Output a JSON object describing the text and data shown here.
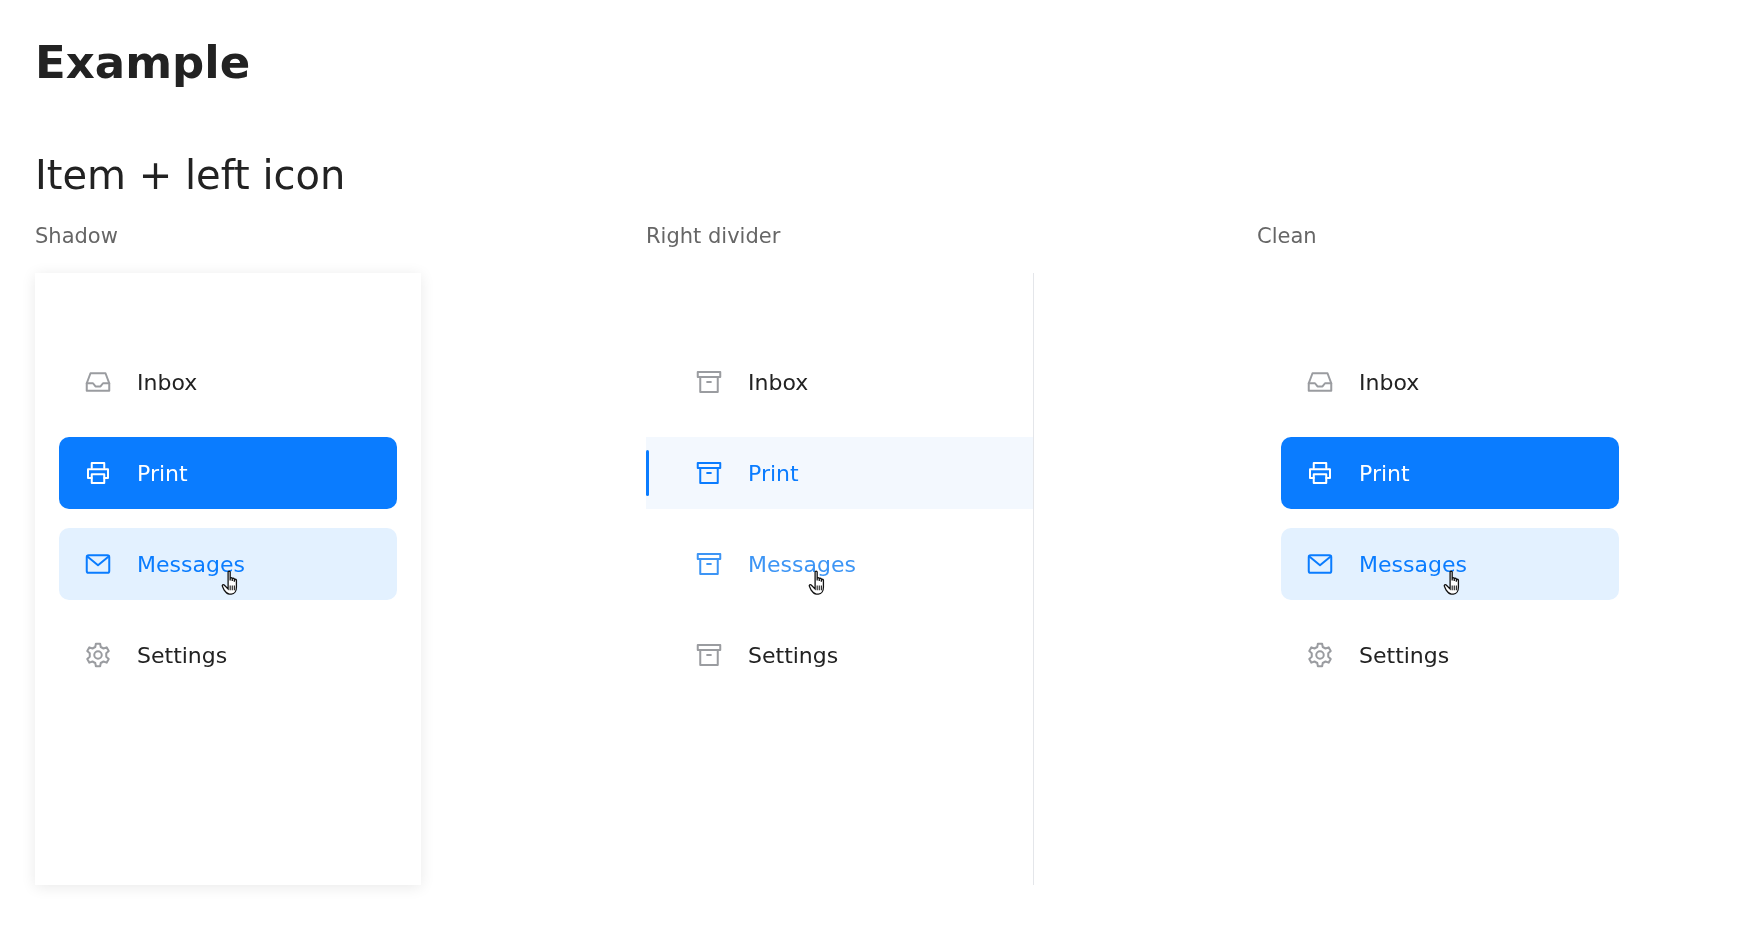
{
  "title": "Example",
  "section": "Item + left icon",
  "columns": [
    {
      "label": "Shadow",
      "kind": "shadow",
      "items": [
        {
          "label": "Inbox",
          "kind": "inbox",
          "selected": false,
          "hovered": false
        },
        {
          "label": "Print",
          "kind": "printer",
          "selected": true,
          "hovered": false
        },
        {
          "label": "Messages",
          "kind": "envelope",
          "selected": false,
          "hovered": true
        },
        {
          "label": "Settings",
          "kind": "gear",
          "selected": false,
          "hovered": false
        }
      ]
    },
    {
      "label": "Right divider",
      "kind": "divider",
      "items": [
        {
          "label": "Inbox",
          "kind": "box",
          "selected": false,
          "hovered": false
        },
        {
          "label": "Print",
          "kind": "box",
          "selected": true,
          "hovered": false
        },
        {
          "label": "Messages",
          "kind": "box",
          "selected": false,
          "hovered": true
        },
        {
          "label": "Settings",
          "kind": "box",
          "selected": false,
          "hovered": false
        }
      ]
    },
    {
      "label": "Clean",
      "kind": "clean",
      "items": [
        {
          "label": "Inbox",
          "kind": "inbox",
          "selected": false,
          "hovered": false
        },
        {
          "label": "Print",
          "kind": "printer",
          "selected": true,
          "hovered": false
        },
        {
          "label": "Messages",
          "kind": "envelope",
          "selected": false,
          "hovered": true
        },
        {
          "label": "Settings",
          "kind": "gear",
          "selected": false,
          "hovered": false
        }
      ]
    }
  ]
}
